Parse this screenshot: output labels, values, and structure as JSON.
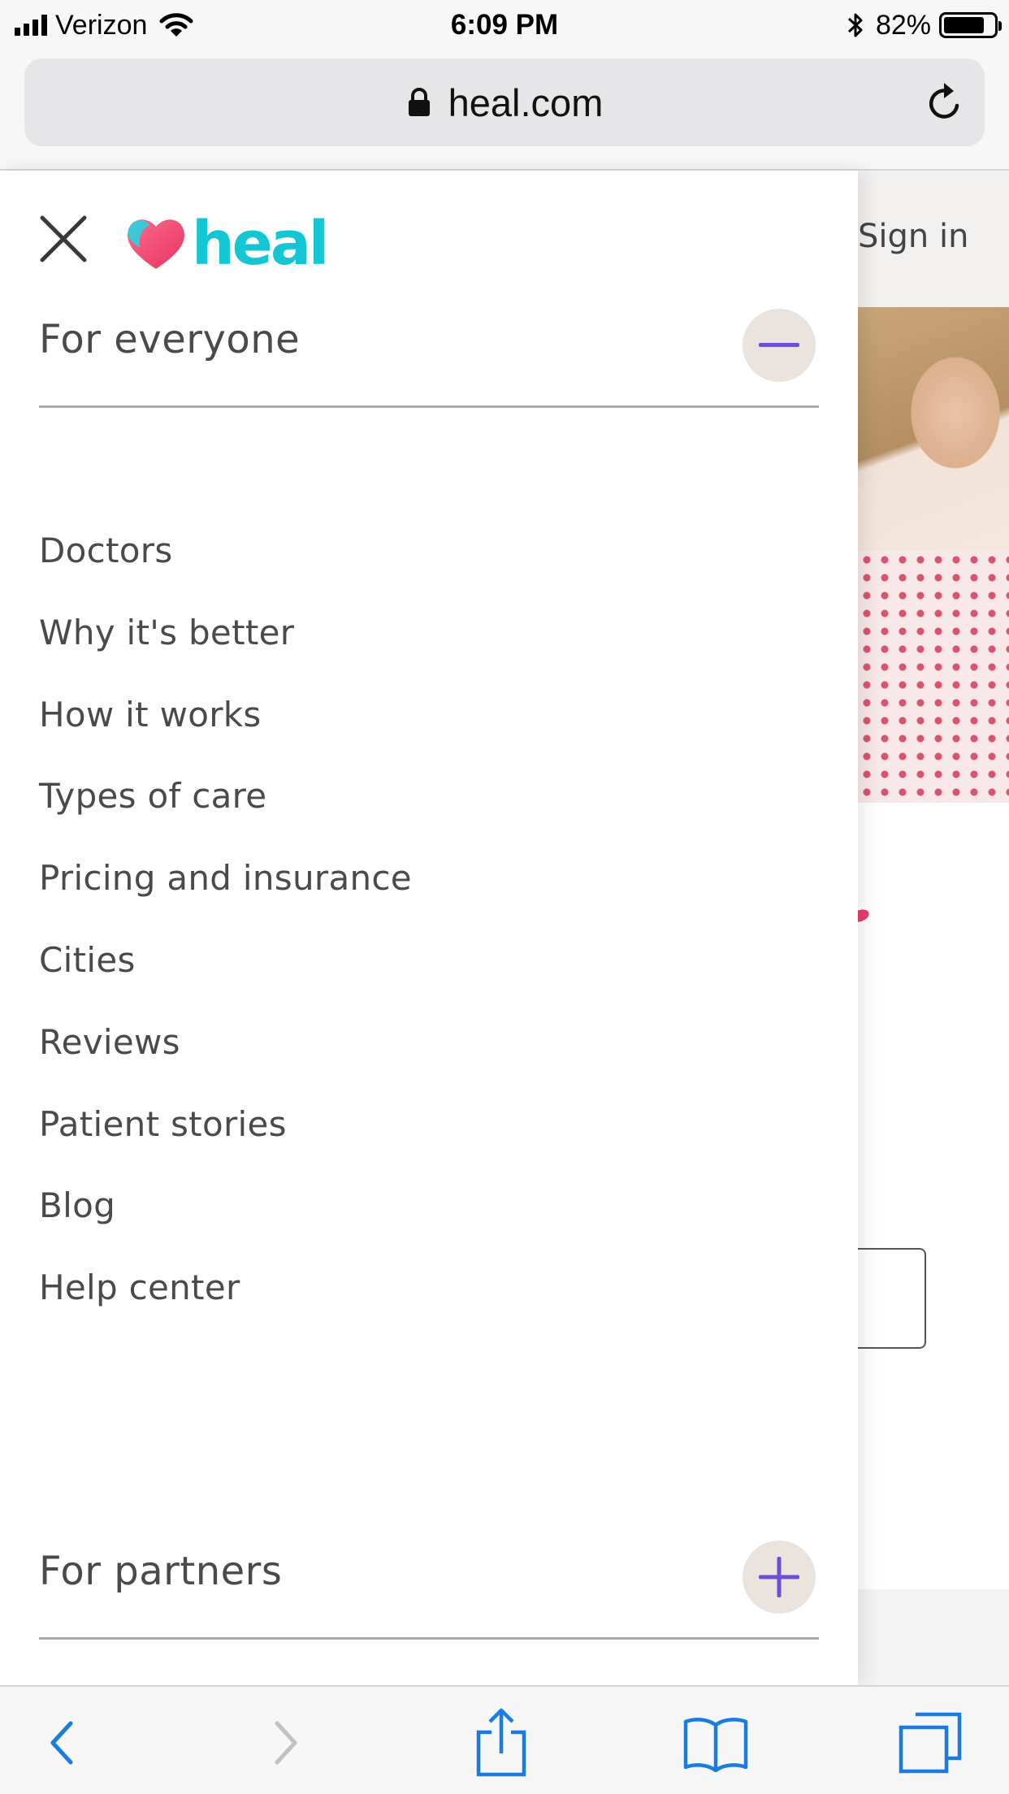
{
  "status_bar": {
    "carrier": "Verizon",
    "time": "6:09 PM",
    "battery_percent": "82%",
    "battery_level": 0.82,
    "signal_bars": 4
  },
  "browser": {
    "url": "heal.com",
    "icons": {
      "lock": "lock-icon",
      "reload": "reload-icon",
      "back": "chevron-left-icon",
      "forward": "chevron-right-icon",
      "share": "share-icon",
      "bookmarks": "book-icon",
      "tabs": "tabs-icon"
    },
    "accent_color": "#1a7be0"
  },
  "page": {
    "sign_in_label": "Sign in"
  },
  "menu": {
    "brand": {
      "name": "heal",
      "color": "#12c6d3",
      "heart_color": "#f0426e"
    },
    "toggle_color": "#6b4fd8",
    "sections": [
      {
        "title": "For everyone",
        "expanded": true,
        "items": [
          "Doctors",
          "Why it's better",
          "How it works",
          "Types of care",
          "Pricing and insurance",
          "Cities",
          "Reviews",
          "Patient stories",
          "Blog",
          "Help center"
        ]
      },
      {
        "title": "For partners",
        "expanded": false,
        "items": []
      }
    ]
  }
}
